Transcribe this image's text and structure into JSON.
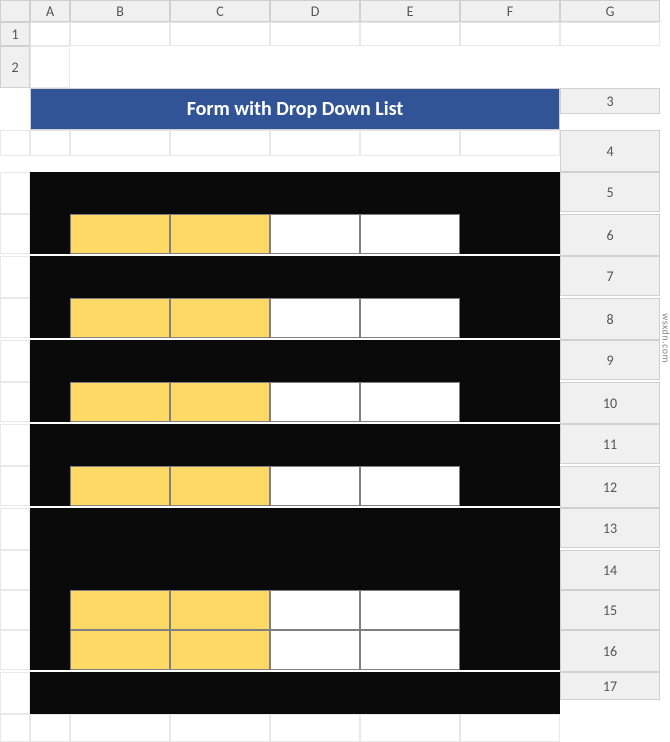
{
  "columns": [
    "",
    "A",
    "B",
    "C",
    "D",
    "E",
    "F",
    "G"
  ],
  "rows": [
    "1",
    "2",
    "3",
    "4",
    "5",
    "6",
    "7",
    "8",
    "9",
    "10",
    "11",
    "12",
    "13",
    "14",
    "15",
    "16",
    "17"
  ],
  "title": "Form with Drop Down List",
  "form_rows": [
    {
      "row": 5,
      "label": "",
      "value": ""
    },
    {
      "row": 7,
      "label": "",
      "value": ""
    },
    {
      "row": 9,
      "label": "",
      "value": ""
    },
    {
      "row": 11,
      "label": "",
      "value": ""
    },
    {
      "row": 14,
      "label": "",
      "value": ""
    },
    {
      "row": 15,
      "label": "",
      "value": ""
    }
  ],
  "colors": {
    "header_bg": "#305496",
    "header_text": "#ffffff",
    "form_bg": "#0a0a0a",
    "label_bg": "#ffd966",
    "input_bg": "#ffffff"
  },
  "watermark": "wsxdn.com"
}
